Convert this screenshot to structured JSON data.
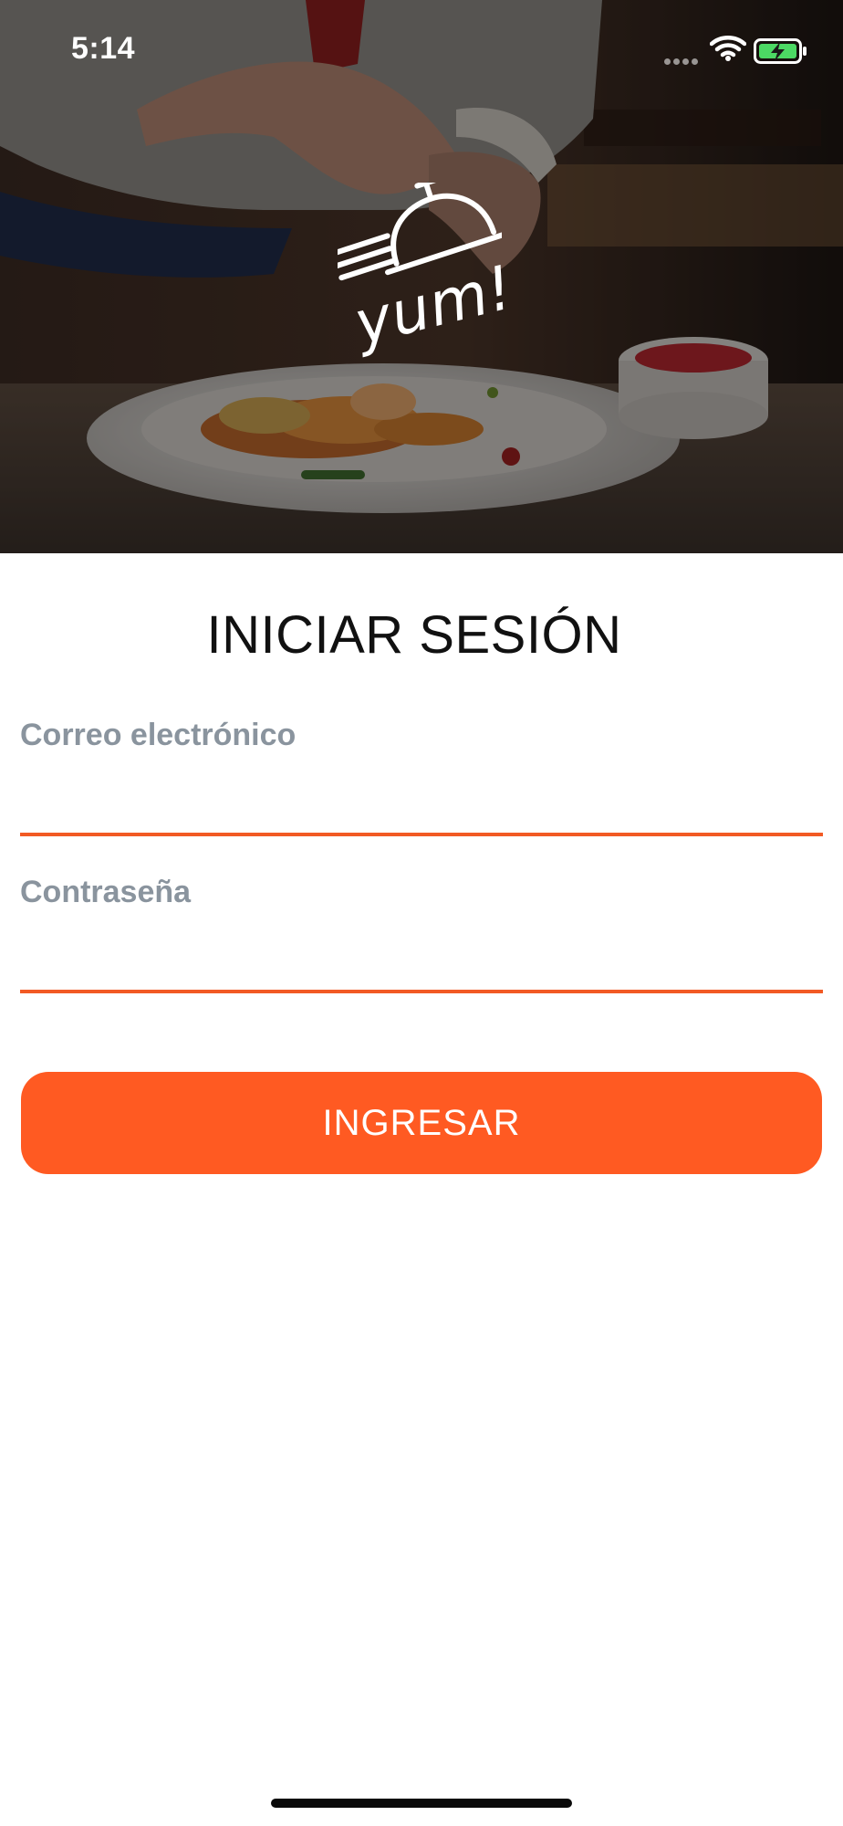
{
  "status_bar": {
    "time": "5:14",
    "icons": [
      "cellular-signal-icon",
      "wifi-icon",
      "battery-charging-icon"
    ]
  },
  "hero": {
    "image": "chef-plating-dish-photo",
    "logo_text": "yum!",
    "logo_icon": "serving-cloche-icon"
  },
  "login": {
    "title": "INICIAR SESIÓN",
    "email_label": "Correo electrónico",
    "email_value": "",
    "password_label": "Contraseña",
    "password_value": "",
    "submit_label": "INGRESAR"
  },
  "colors": {
    "accent": "#ff5a22",
    "underline": "#f25a24",
    "label": "#8a949e",
    "title": "#111111"
  }
}
